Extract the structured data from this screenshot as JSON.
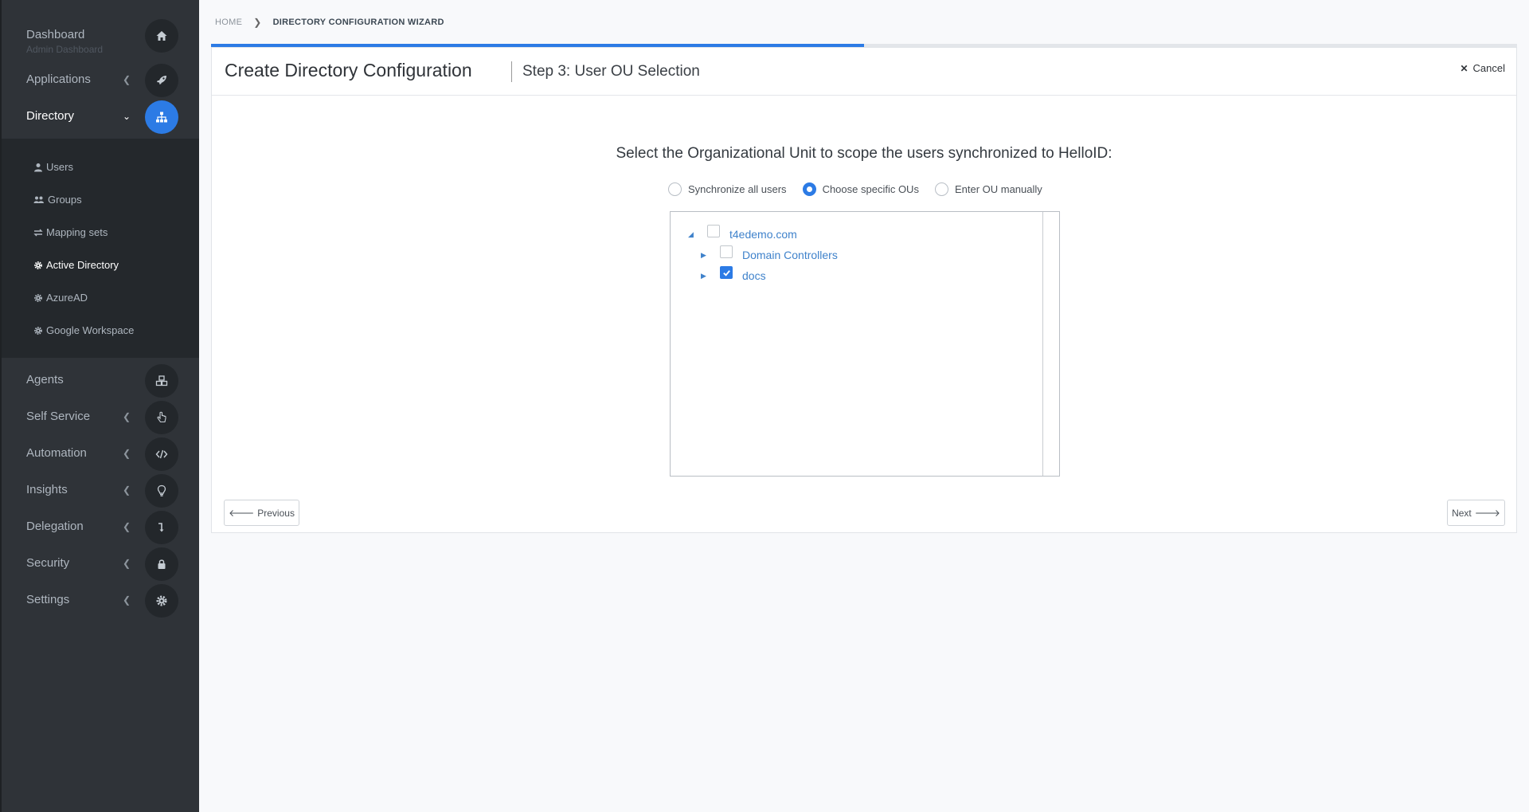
{
  "sidebar": {
    "dashboard": {
      "label": "Dashboard",
      "sublabel": "Admin Dashboard",
      "icon": "home-icon"
    },
    "applications": {
      "label": "Applications",
      "icon": "rocket-icon"
    },
    "directory": {
      "label": "Directory",
      "icon": "sitemap-icon"
    },
    "directory_items": [
      {
        "label": "Users",
        "icon": "user-icon"
      },
      {
        "label": "Groups",
        "icon": "users-icon"
      },
      {
        "label": "Mapping sets",
        "icon": "exchange-icon"
      },
      {
        "label": "Active Directory",
        "icon": "gear-icon"
      },
      {
        "label": "AzureAD",
        "icon": "gear-icon"
      },
      {
        "label": "Google Workspace",
        "icon": "gear-icon"
      }
    ],
    "agents": {
      "label": "Agents",
      "icon": "cubes-icon"
    },
    "self_service": {
      "label": "Self Service",
      "icon": "hand-pointer-icon"
    },
    "automation": {
      "label": "Automation",
      "icon": "code-icon"
    },
    "insights": {
      "label": "Insights",
      "icon": "lightbulb-icon"
    },
    "delegation": {
      "label": "Delegation",
      "icon": "level-down-icon"
    },
    "security": {
      "label": "Security",
      "icon": "lock-icon"
    },
    "settings": {
      "label": "Settings",
      "icon": "gear-icon"
    }
  },
  "breadcrumb": {
    "home": "HOME",
    "current": "DIRECTORY CONFIGURATION WIZARD"
  },
  "wizard": {
    "progress_percent": 50,
    "title": "Create Directory Configuration",
    "subtitle": "Step 3: User OU Selection",
    "cancel_label": "Cancel",
    "prompt": "Select the Organizational Unit to scope the users synchronized to HelloID:",
    "options": [
      {
        "label": "Synchronize all users",
        "checked": false
      },
      {
        "label": "Choose specific OUs",
        "checked": true
      },
      {
        "label": "Enter OU manually",
        "checked": false
      }
    ],
    "tree": [
      {
        "label": "t4edemo.com",
        "checked": false,
        "expanded": true,
        "level": 0
      },
      {
        "label": "Domain Controllers",
        "checked": false,
        "expanded": false,
        "level": 1
      },
      {
        "label": "docs",
        "checked": true,
        "expanded": false,
        "level": 1
      }
    ],
    "previous_label": "Previous",
    "next_label": "Next"
  },
  "colors": {
    "accent": "#2c7be5",
    "sidebar_bg": "#2f3338",
    "submenu_bg": "#24282c",
    "link": "#3f82cb"
  }
}
